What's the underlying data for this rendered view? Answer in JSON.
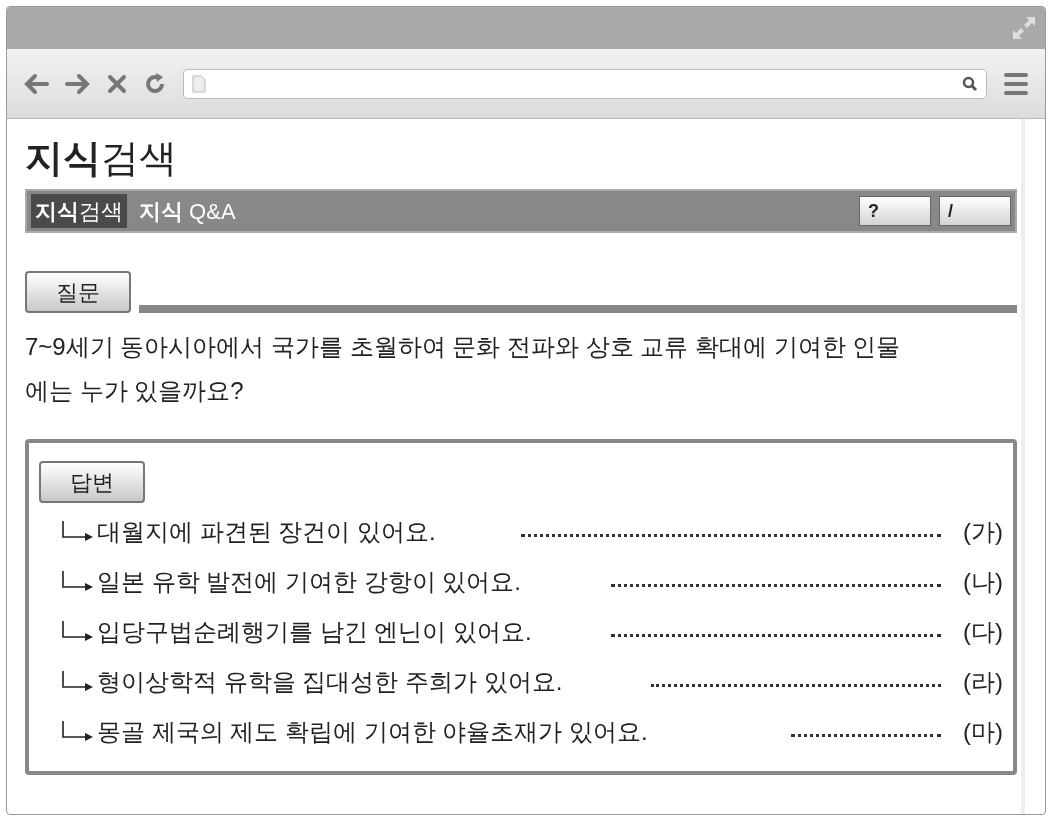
{
  "page": {
    "title": "**지식**검색"
  },
  "tabs": [
    {
      "label": "**지식**검색",
      "selected": true
    },
    {
      "label": "**지식** Q&A",
      "selected": false
    }
  ],
  "tool_buttons": [
    {
      "label": "?"
    },
    {
      "label": "/"
    }
  ],
  "question": {
    "heading": "질문",
    "text": "7~9세기 동아시아에서 국가를 초월하여 문화 전파와 상호 교류 확대에 기여한 인물에는 누가 있을까요?"
  },
  "answer": {
    "heading": "답변",
    "items": [
      {
        "text": "대월지에 파견된 장건이 있어요.",
        "mark": "(가)"
      },
      {
        "text": "일본 유학 발전에 기여한 강항이 있어요.",
        "mark": "(나)"
      },
      {
        "text": "입당구법순례행기를 남긴 엔닌이 있어요.",
        "mark": "(다)"
      },
      {
        "text": "형이상학적 유학을 집대성한 주희가 있어요.",
        "mark": "(라)"
      },
      {
        "text": "몽골 제국의 제도 확립에 기여한 야율초재가 있어요.",
        "mark": "(마)"
      }
    ]
  }
}
